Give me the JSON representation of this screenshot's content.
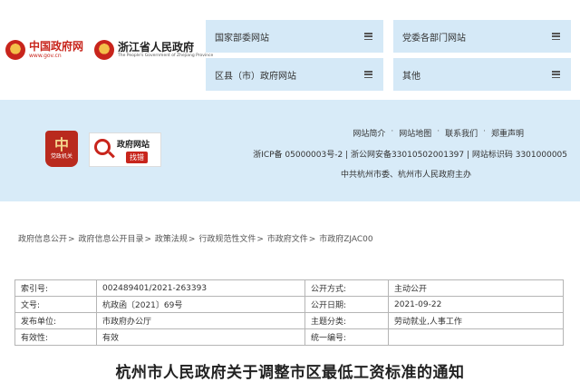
{
  "header": {
    "logo_gov": {
      "title": "中国政府网",
      "subtitle": "www.gov.cn"
    },
    "logo_zj": {
      "title": "浙江省人民政府",
      "subtitle": "The People's Government of Zhejiang Province"
    },
    "nav": [
      {
        "label": "国家部委网站"
      },
      {
        "label": "党委各部门网站"
      },
      {
        "label": "区县（市）政府网站"
      },
      {
        "label": "其他"
      }
    ]
  },
  "footer": {
    "badge_party": {
      "glyph": "中",
      "label": "党政机关"
    },
    "badge_report": {
      "title": "政府网站",
      "button": "找错"
    },
    "links": [
      "网站简介",
      "网站地图",
      "联系我们",
      "郑重声明"
    ],
    "link_sep": "·",
    "icp": "浙ICP备 05000003号-2 | 浙公网安备33010502001397 | 网站标识码 3301000005",
    "sponsor": "中共杭州市委、杭州市人民政府主办"
  },
  "breadcrumb": [
    "政府信息公开",
    "政府信息公开目录",
    "政策法规",
    "行政规范性文件",
    "市政府文件",
    "市政府ZJAC00"
  ],
  "breadcrumb_sep": ">",
  "meta": {
    "rows": [
      {
        "k1": "索引号:",
        "v1": "002489401/2021-263393",
        "k2": "公开方式:",
        "v2": "主动公开"
      },
      {
        "k1": "文号:",
        "v1": "杭政函〔2021〕69号",
        "k2": "公开日期:",
        "v2": "2021-09-22"
      },
      {
        "k1": "发布单位:",
        "v1": "市政府办公厅",
        "k2": "主题分类:",
        "v2": "劳动就业,人事工作"
      },
      {
        "k1": "有效性:",
        "v1": "有效",
        "k2": "统一编号:",
        "v2": ""
      }
    ]
  },
  "title": "杭州市人民政府关于调整市区最低工资标准的通知"
}
